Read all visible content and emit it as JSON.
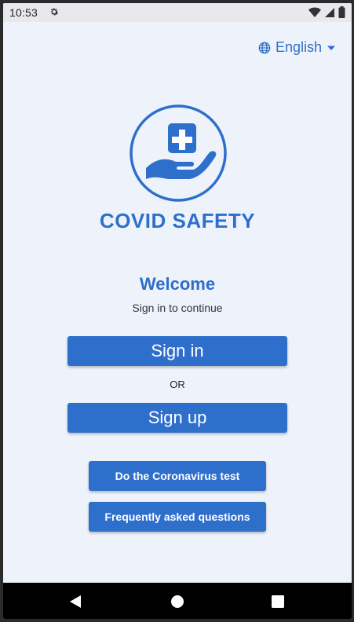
{
  "status_bar": {
    "time": "10:53",
    "icons": [
      "gear-icon",
      "wifi-icon",
      "signal-icon",
      "battery-icon"
    ]
  },
  "language": {
    "label": "English",
    "icons": [
      "globe-icon",
      "dropdown-arrow-icon"
    ]
  },
  "brand": {
    "name": "COVID SAFETY",
    "logo": "hand-holding-medical-cross-icon"
  },
  "welcome": {
    "title": "Welcome",
    "subtitle": "Sign in to continue"
  },
  "actions": {
    "sign_in": "Sign in",
    "or": "OR",
    "sign_up": "Sign up",
    "test": "Do the Coronavirus test",
    "faq": "Frequently asked questions"
  },
  "colors": {
    "primary": "#2f6fcc",
    "background": "#eef3fb"
  },
  "nav": {
    "icons": [
      "back-icon",
      "home-icon",
      "recent-apps-icon"
    ]
  }
}
